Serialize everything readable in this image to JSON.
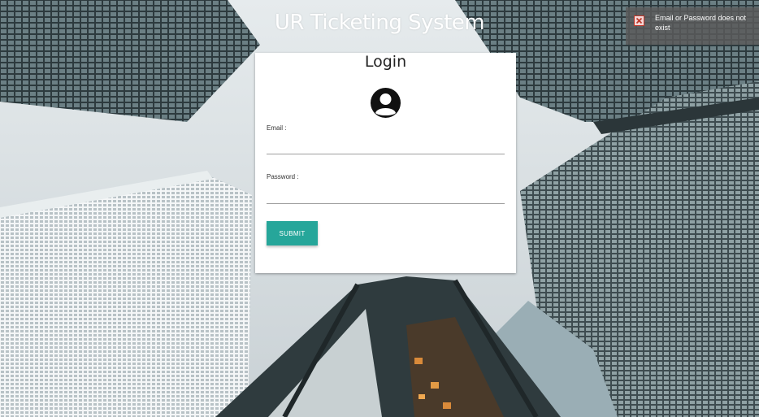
{
  "app": {
    "title": "UR Ticketing System"
  },
  "login": {
    "title": "Login",
    "email_label": "Email :",
    "email_value": "",
    "password_label": "Password :",
    "password_value": "",
    "submit_label": "SUBMIT"
  },
  "toast": {
    "message": "Email or Password does not exist",
    "icon": "error-close-icon"
  },
  "colors": {
    "accent": "#26a69a",
    "toast_bg": "#5a5a5a",
    "error_icon": "#c0392b"
  }
}
